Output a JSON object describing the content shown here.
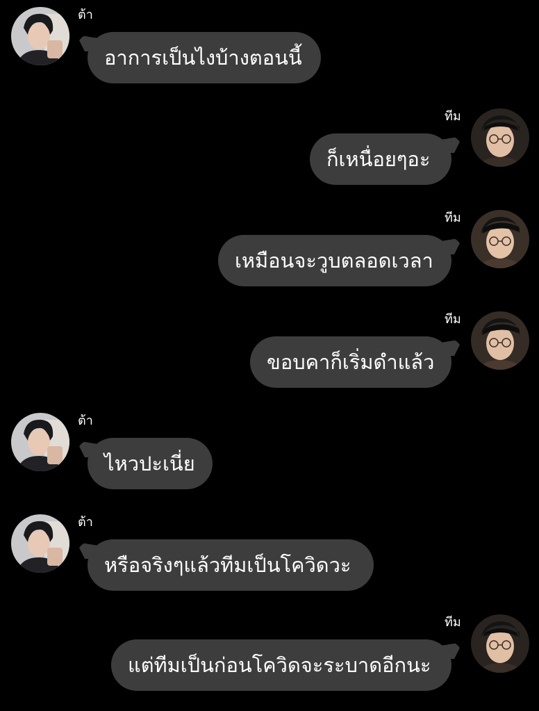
{
  "participants": {
    "left": {
      "name": "ต้า",
      "avatar_icon": "person-photo-avatar-ta"
    },
    "right": {
      "name": "ทีม",
      "avatar_icon": "person-photo-avatar-team-glasses"
    }
  },
  "colors": {
    "background": "#000000",
    "bubble": "#3d3d3d",
    "text": "#ffffff"
  },
  "messages": [
    {
      "sender": "ต้า",
      "side": "left",
      "text": "อาการเป็นไงบ้างตอนนี้"
    },
    {
      "sender": "ทีม",
      "side": "right",
      "text": "ก็เหนื่อยๆอะ"
    },
    {
      "sender": "ทีม",
      "side": "right",
      "text": "เหมือนจะวูบตลอดเวลา"
    },
    {
      "sender": "ทีม",
      "side": "right",
      "text": "ขอบคาก็เริ่มดำแล้ว"
    },
    {
      "sender": "ต้า",
      "side": "left",
      "text": "ไหวปะเนี่ย"
    },
    {
      "sender": "ต้า",
      "side": "left",
      "text": "หรือจริงๆแล้วทีมเป็นโควิดวะ"
    },
    {
      "sender": "ทีม",
      "side": "right",
      "text": "แต่ทีมเป็นก่อนโควิดจะระบาดอีกนะ"
    }
  ]
}
